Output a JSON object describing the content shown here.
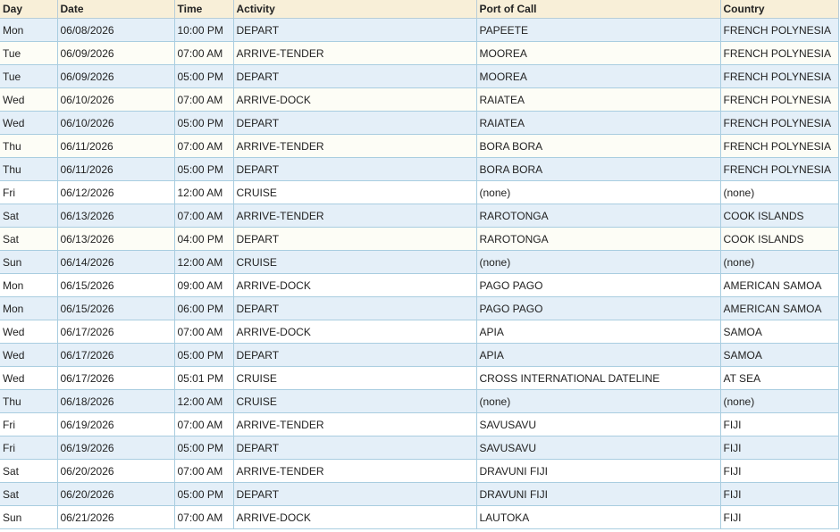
{
  "headers": {
    "day": "Day",
    "date": "Date",
    "time": "Time",
    "activity": "Activity",
    "port": "Port of Call",
    "country": "Country"
  },
  "rows": [
    {
      "shade": "blue",
      "day": "Mon",
      "date": "06/08/2026",
      "time": "10:00 PM",
      "activity": "DEPART",
      "port": "PAPEETE",
      "country": "FRENCH POLYNESIA"
    },
    {
      "shade": "cream",
      "day": "Tue",
      "date": "06/09/2026",
      "time": "07:00 AM",
      "activity": "ARRIVE-TENDER",
      "port": "MOOREA",
      "country": "FRENCH POLYNESIA"
    },
    {
      "shade": "blue",
      "day": "Tue",
      "date": "06/09/2026",
      "time": "05:00 PM",
      "activity": "DEPART",
      "port": "MOOREA",
      "country": "FRENCH POLYNESIA"
    },
    {
      "shade": "cream",
      "day": "Wed",
      "date": "06/10/2026",
      "time": "07:00 AM",
      "activity": "ARRIVE-DOCK",
      "port": "RAIATEA",
      "country": "FRENCH POLYNESIA"
    },
    {
      "shade": "blue",
      "day": "Wed",
      "date": "06/10/2026",
      "time": "05:00 PM",
      "activity": "DEPART",
      "port": "RAIATEA",
      "country": "FRENCH POLYNESIA"
    },
    {
      "shade": "cream",
      "day": "Thu",
      "date": "06/11/2026",
      "time": "07:00 AM",
      "activity": "ARRIVE-TENDER",
      "port": "BORA BORA",
      "country": "FRENCH POLYNESIA"
    },
    {
      "shade": "blue",
      "day": "Thu",
      "date": "06/11/2026",
      "time": "05:00 PM",
      "activity": "DEPART",
      "port": "BORA BORA",
      "country": "FRENCH POLYNESIA"
    },
    {
      "shade": "white",
      "day": "Fri",
      "date": "06/12/2026",
      "time": "12:00 AM",
      "activity": "CRUISE",
      "port": "(none)",
      "country": "(none)"
    },
    {
      "shade": "blue",
      "day": "Sat",
      "date": "06/13/2026",
      "time": "07:00 AM",
      "activity": "ARRIVE-TENDER",
      "port": "RAROTONGA",
      "country": "COOK ISLANDS"
    },
    {
      "shade": "cream",
      "day": "Sat",
      "date": "06/13/2026",
      "time": "04:00 PM",
      "activity": "DEPART",
      "port": "RAROTONGA",
      "country": "COOK ISLANDS"
    },
    {
      "shade": "blue",
      "day": "Sun",
      "date": "06/14/2026",
      "time": "12:00 AM",
      "activity": "CRUISE",
      "port": "(none)",
      "country": "(none)"
    },
    {
      "shade": "white",
      "day": "Mon",
      "date": "06/15/2026",
      "time": "09:00 AM",
      "activity": "ARRIVE-DOCK",
      "port": "PAGO PAGO",
      "country": "AMERICAN SAMOA"
    },
    {
      "shade": "blue",
      "day": "Mon",
      "date": "06/15/2026",
      "time": "06:00 PM",
      "activity": "DEPART",
      "port": "PAGO PAGO",
      "country": "AMERICAN SAMOA"
    },
    {
      "shade": "white",
      "day": "Wed",
      "date": "06/17/2026",
      "time": "07:00 AM",
      "activity": "ARRIVE-DOCK",
      "port": "APIA",
      "country": "SAMOA"
    },
    {
      "shade": "blue",
      "day": "Wed",
      "date": "06/17/2026",
      "time": "05:00 PM",
      "activity": "DEPART",
      "port": "APIA",
      "country": "SAMOA"
    },
    {
      "shade": "white",
      "day": "Wed",
      "date": "06/17/2026",
      "time": "05:01 PM",
      "activity": "CRUISE",
      "port": "CROSS INTERNATIONAL DATELINE",
      "country": "AT SEA"
    },
    {
      "shade": "blue",
      "day": "Thu",
      "date": "06/18/2026",
      "time": "12:00 AM",
      "activity": "CRUISE",
      "port": "(none)",
      "country": "(none)"
    },
    {
      "shade": "white",
      "day": "Fri",
      "date": "06/19/2026",
      "time": "07:00 AM",
      "activity": "ARRIVE-TENDER",
      "port": "SAVUSAVU",
      "country": "FIJI"
    },
    {
      "shade": "blue",
      "day": "Fri",
      "date": "06/19/2026",
      "time": "05:00 PM",
      "activity": "DEPART",
      "port": "SAVUSAVU",
      "country": "FIJI"
    },
    {
      "shade": "white",
      "day": "Sat",
      "date": "06/20/2026",
      "time": "07:00 AM",
      "activity": "ARRIVE-TENDER",
      "port": "DRAVUNI FIJI",
      "country": "FIJI"
    },
    {
      "shade": "blue",
      "day": "Sat",
      "date": "06/20/2026",
      "time": "05:00 PM",
      "activity": "DEPART",
      "port": "DRAVUNI FIJI",
      "country": "FIJI"
    },
    {
      "shade": "white",
      "day": "Sun",
      "date": "06/21/2026",
      "time": "07:00 AM",
      "activity": "ARRIVE-DOCK",
      "port": "LAUTOKA",
      "country": "FIJI"
    }
  ],
  "colors": {
    "header_bg": "#f8efd8",
    "row_blue": "#e4eff8",
    "row_cream": "#fdfdf6",
    "row_white": "#ffffff",
    "grid_line": "#a9cde0"
  }
}
